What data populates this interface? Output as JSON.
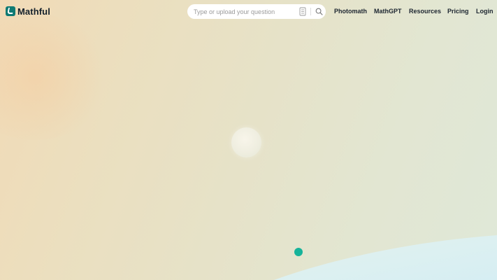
{
  "header": {
    "brand": "Mathful",
    "search": {
      "placeholder": "Type or upload your question",
      "value": "",
      "upload_icon": "document-upload-icon",
      "search_icon": "search-icon"
    },
    "nav": [
      {
        "label": "Photomath"
      },
      {
        "label": "MathGPT"
      },
      {
        "label": "Resources"
      },
      {
        "label": "Pricing"
      },
      {
        "label": "Login"
      }
    ]
  },
  "colors": {
    "brand": "#0f7a73",
    "accent_dot": "#16b39a",
    "wave": "#d8eef0",
    "background_start": "#f1dab6",
    "background_end": "#dfe8d8"
  }
}
